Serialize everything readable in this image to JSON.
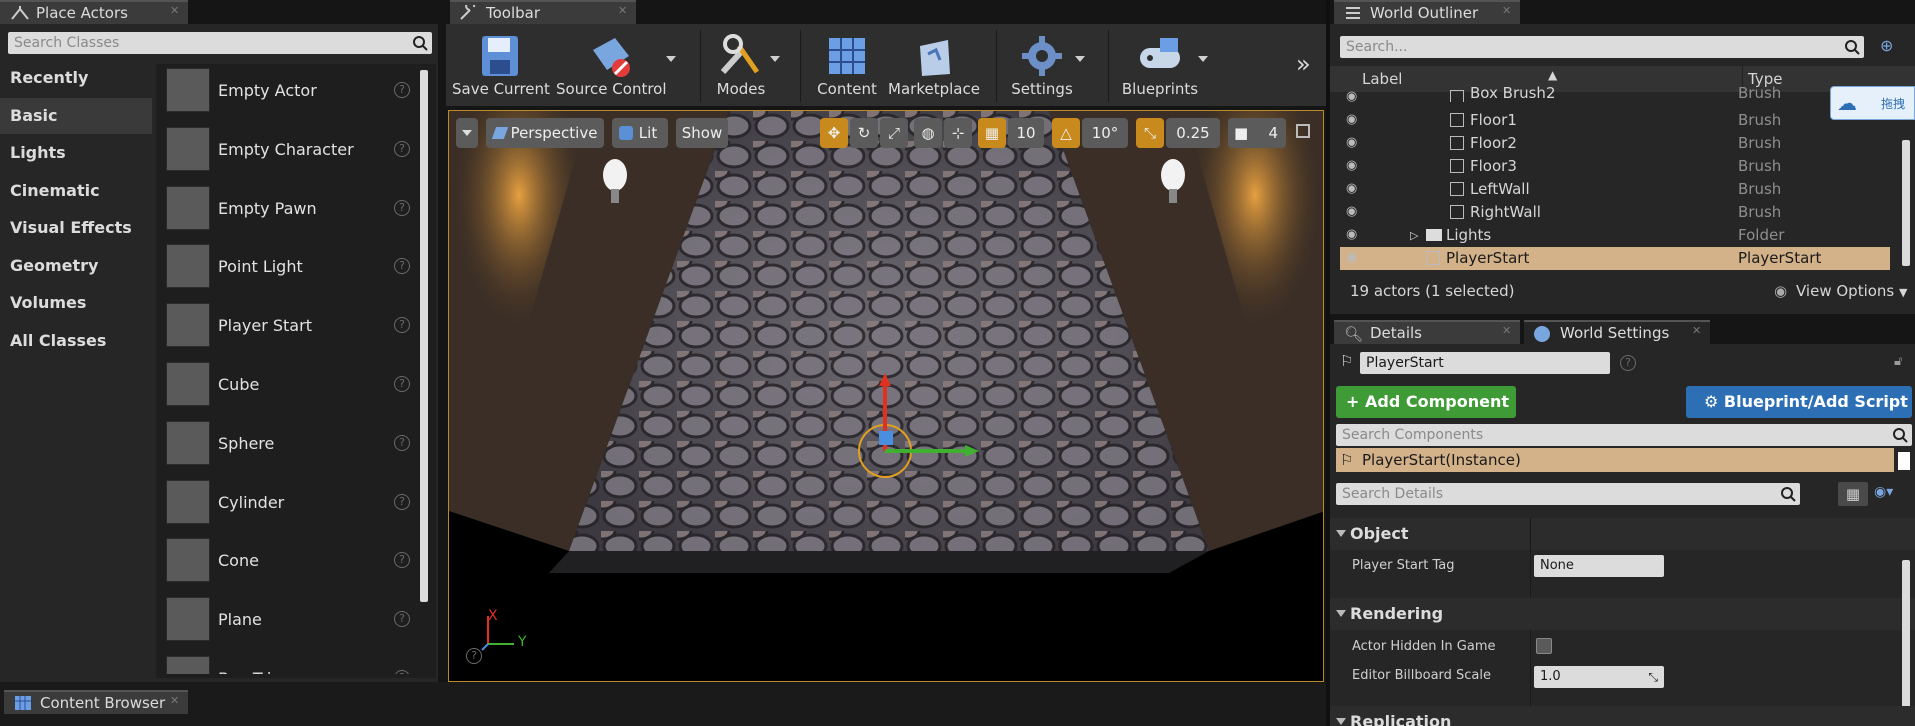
{
  "place_actors": {
    "tab_label": "Place Actors",
    "search_placeholder": "Search Classes",
    "categories": [
      "Recently Placed",
      "Basic",
      "Lights",
      "Cinematic",
      "Visual Effects",
      "Geometry",
      "Volumes",
      "All Classes"
    ],
    "selected_category": "Basic",
    "items": [
      "Empty Actor",
      "Empty Character",
      "Empty Pawn",
      "Point Light",
      "Player Start",
      "Cube",
      "Sphere",
      "Cylinder",
      "Cone",
      "Plane",
      "Box Trigger"
    ]
  },
  "toolbar": {
    "tab_label": "Toolbar",
    "buttons": [
      "Save Current",
      "Source Control",
      "Modes",
      "Content",
      "Marketplace",
      "Settings",
      "Blueprints"
    ]
  },
  "viewport": {
    "perspective_label": "Perspective",
    "lit_label": "Lit",
    "show_label": "Show",
    "grid_snap": "10",
    "rotation_snap": "10°",
    "scale_snap": "0.25",
    "camera_speed": "4",
    "axis_x": "X",
    "axis_y": "Y"
  },
  "world_outliner": {
    "tab_label": "World Outliner",
    "search_placeholder": "Search...",
    "col_label": "Label",
    "col_type": "Type",
    "rows": [
      {
        "name": "Box Brush2",
        "type": "Brush"
      },
      {
        "name": "Floor1",
        "type": "Brush"
      },
      {
        "name": "Floor2",
        "type": "Brush"
      },
      {
        "name": "Floor3",
        "type": "Brush"
      },
      {
        "name": "LeftWall",
        "type": "Brush"
      },
      {
        "name": "RightWall",
        "type": "Brush"
      },
      {
        "name": "Lights",
        "type": "Folder"
      },
      {
        "name": "PlayerStart",
        "type": "PlayerStart"
      }
    ],
    "actor_count": "19 actors (1 selected)",
    "view_options": "View Options",
    "drag_badge": "拖拽"
  },
  "details": {
    "tab_label": "Details",
    "world_settings_tab": "World Settings",
    "name_value": "PlayerStart",
    "add_component": "Add Component",
    "blueprint_script": "Blueprint/Add Script",
    "search_components": "Search Components",
    "component_instance": "PlayerStart(Instance)",
    "search_details": "Search Details",
    "sections": {
      "object": "Object",
      "rendering": "Rendering",
      "replication": "Replication"
    },
    "player_start_tag_label": "Player Start Tag",
    "player_start_tag_value": "None",
    "actor_hidden_label": "Actor Hidden In Game",
    "billboard_scale_label": "Editor Billboard Scale",
    "billboard_scale_value": "1.0"
  },
  "content_browser": {
    "tab_label": "Content Browser"
  },
  "colors": {
    "accent_orange": "#c88a1c",
    "selection": "#d3b28a",
    "add_green": "#3e9b35",
    "blueprint_blue": "#2d6fb5"
  }
}
